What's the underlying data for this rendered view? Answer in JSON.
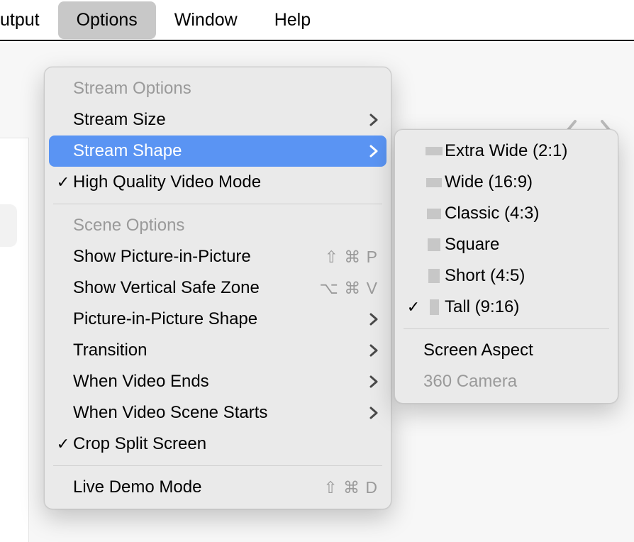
{
  "menubar": {
    "items": [
      {
        "label": "utput",
        "active": false,
        "partial": true
      },
      {
        "label": "Options",
        "active": true
      },
      {
        "label": "Window",
        "active": false
      },
      {
        "label": "Help",
        "active": false
      }
    ]
  },
  "options_menu": {
    "section_stream": "Stream Options",
    "stream_size": {
      "label": "Stream Size"
    },
    "stream_shape": {
      "label": "Stream Shape"
    },
    "hq_video": {
      "label": "High Quality Video Mode",
      "checked": true
    },
    "section_scene": "Scene Options",
    "show_pip": {
      "label": "Show Picture-in-Picture",
      "shortcut": "⇧ ⌘ P"
    },
    "show_vsz": {
      "label": "Show Vertical Safe Zone",
      "shortcut": "⌥ ⌘ V"
    },
    "pip_shape": {
      "label": "Picture-in-Picture Shape"
    },
    "transition": {
      "label": "Transition"
    },
    "when_video_ends": {
      "label": "When Video Ends"
    },
    "when_scene_starts": {
      "label": "When Video Scene Starts"
    },
    "crop_split": {
      "label": "Crop Split Screen",
      "checked": true
    },
    "live_demo": {
      "label": "Live Demo Mode",
      "shortcut": "⇧ ⌘ D"
    }
  },
  "shape_menu": {
    "items": [
      {
        "label": "Extra Wide (2:1)",
        "swatch": "sw-extra-wide",
        "checked": false
      },
      {
        "label": "Wide (16:9)",
        "swatch": "sw-wide",
        "checked": false
      },
      {
        "label": "Classic (4:3)",
        "swatch": "sw-classic",
        "checked": false
      },
      {
        "label": "Square",
        "swatch": "sw-square",
        "checked": false
      },
      {
        "label": "Short (4:5)",
        "swatch": "sw-short",
        "checked": false
      },
      {
        "label": "Tall (9:16)",
        "swatch": "sw-tall",
        "checked": true
      }
    ],
    "screen_aspect": "Screen Aspect",
    "camera_360": "360 Camera"
  }
}
